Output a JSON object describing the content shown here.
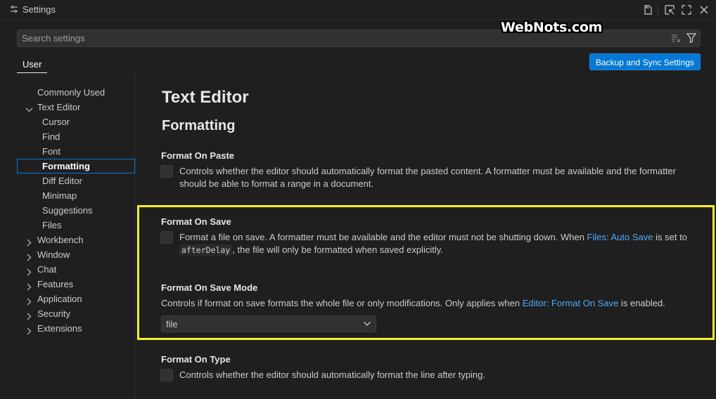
{
  "window": {
    "title": "Settings"
  },
  "watermark": "WebNots.com",
  "search": {
    "placeholder": "Search settings"
  },
  "tabs": {
    "user": "User"
  },
  "sync_button": "Backup and Sync Settings",
  "tree": {
    "commonly_used": "Commonly Used",
    "text_editor": "Text Editor",
    "cursor": "Cursor",
    "find": "Find",
    "font": "Font",
    "formatting": "Formatting",
    "diff_editor": "Diff Editor",
    "minimap": "Minimap",
    "suggestions": "Suggestions",
    "files": "Files",
    "workbench": "Workbench",
    "window": "Window",
    "chat": "Chat",
    "features": "Features",
    "application": "Application",
    "security": "Security",
    "extensions": "Extensions"
  },
  "main": {
    "heading": "Text Editor",
    "subheading": "Formatting",
    "format_on_paste": {
      "title": "Format On Paste",
      "desc_line1": "Controls whether the editor should automatically format the pasted content. A formatter must be available and the formatter",
      "desc_line2": "should be able to format a range in a document."
    },
    "format_on_save": {
      "title": "Format On Save",
      "desc_part1": "Format a file on save. A formatter must be available and the editor must not be shutting down. When ",
      "link": "Files: Auto Save",
      "desc_part2": " is set to",
      "code": "afterDelay",
      "desc_part3": ", the file will only be formatted when saved explicitly."
    },
    "format_on_save_mode": {
      "title": "Format On Save Mode",
      "desc_part1": "Controls if format on save formats the whole file or only modifications. Only applies when ",
      "link": "Editor: Format On Save",
      "desc_part2": " is enabled.",
      "selected": "file"
    },
    "format_on_type": {
      "title": "Format On Type",
      "desc": "Controls whether the editor should automatically format the line after typing."
    }
  },
  "colors": {
    "accent": "#0078d4",
    "link": "#4daafc",
    "highlight": "#f7f225"
  }
}
